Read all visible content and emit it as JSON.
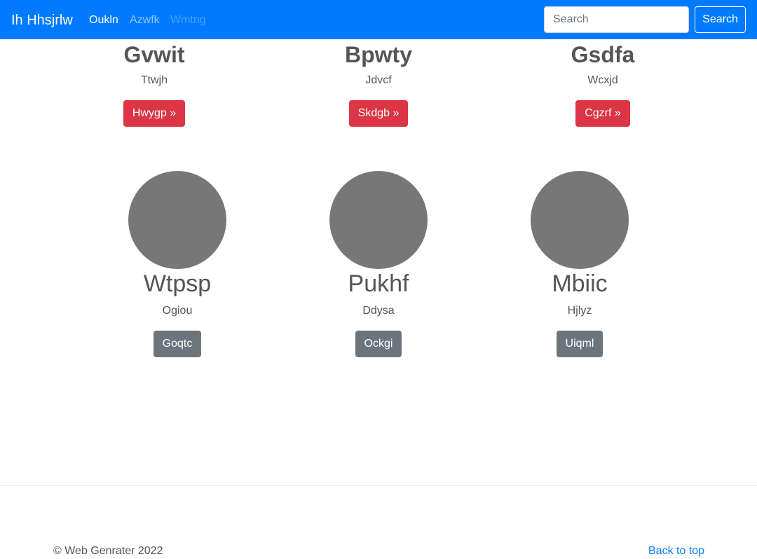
{
  "colors": {
    "navbar": "#007bff",
    "danger": "#dc3545",
    "secondary": "#6c757d",
    "placeholder_circle": "#777777",
    "link": "#007bff"
  },
  "navbar": {
    "brand": "Ih Hhsjrlw",
    "links": [
      "Oukln",
      "Azwfk",
      "Wmtng"
    ],
    "search_placeholder": "Search",
    "search_button": "Search"
  },
  "headings": [
    {
      "title": "Gvwit",
      "subtitle": "Ttwjh",
      "button": "Hwygp »"
    },
    {
      "title": "Bpwty",
      "subtitle": "Jdvcf",
      "button": "Skdgb »"
    },
    {
      "title": "Gsdfa",
      "subtitle": "Wcxjd",
      "button": "Cgzrf »"
    }
  ],
  "marketing": [
    {
      "title": "Wtpsp",
      "subtitle": "Ogiou",
      "button": "Goqtc"
    },
    {
      "title": "Pukhf",
      "subtitle": "Ddysa",
      "button": "Ockgi"
    },
    {
      "title": "Mbiic",
      "subtitle": "Hjlyz",
      "button": "Uiqml"
    }
  ],
  "footer": {
    "copyright": "© Web Genrater 2022",
    "back_to_top": "Back to top"
  }
}
